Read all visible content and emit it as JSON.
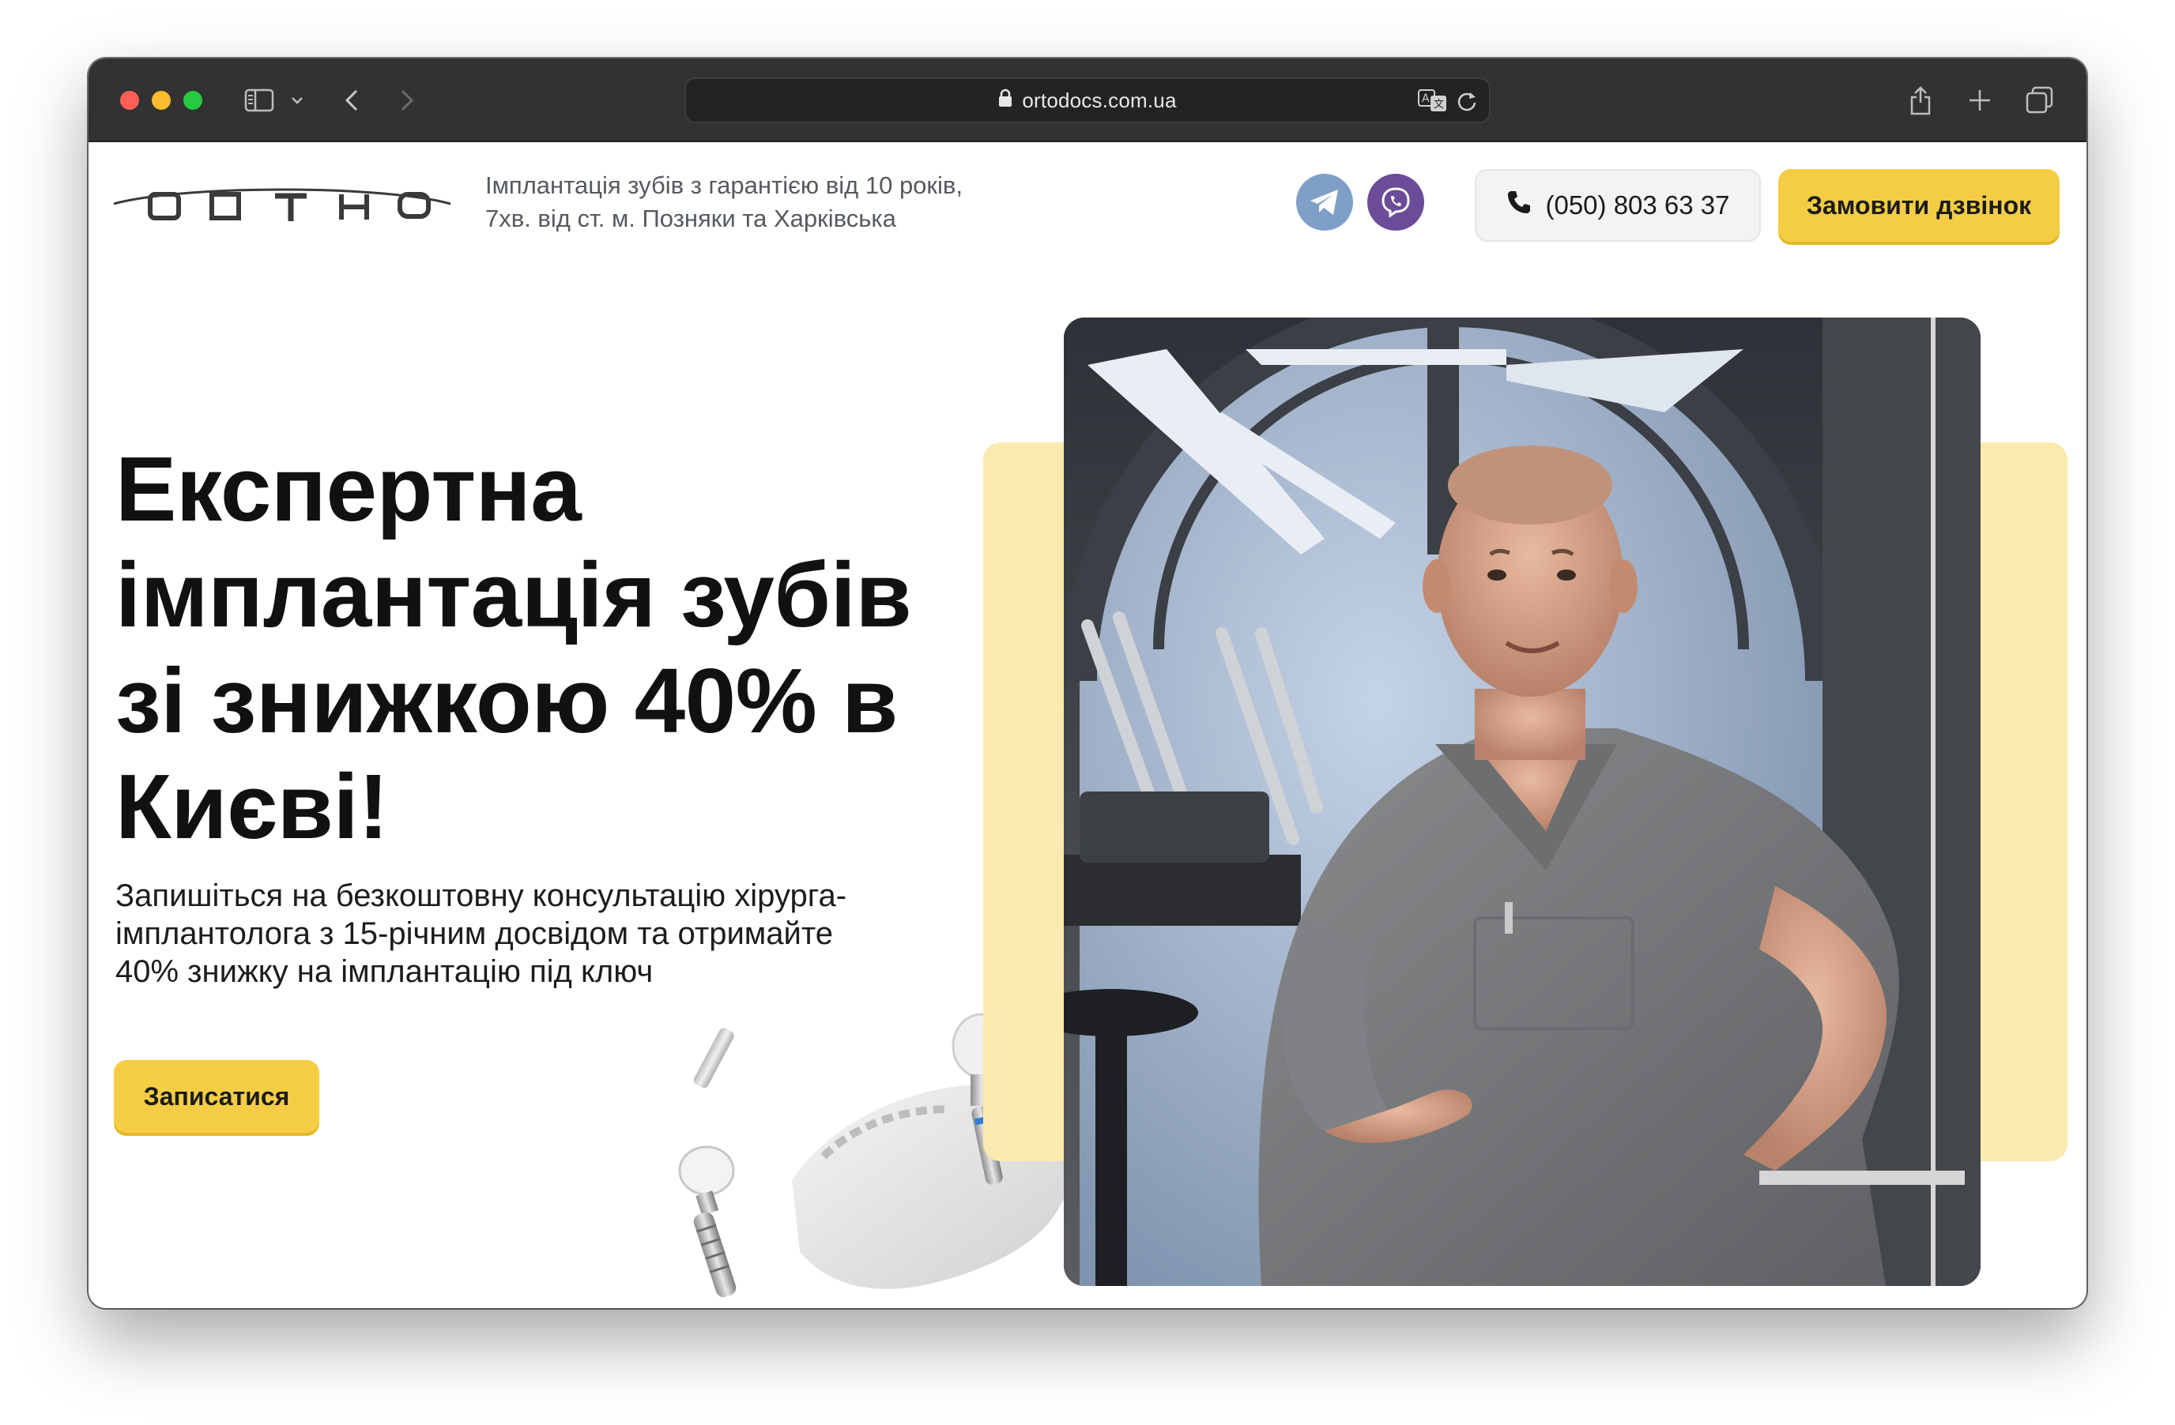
{
  "browser": {
    "url": "ortodocs.com.ua",
    "icons": [
      "sidebar-icon",
      "chevron-down-icon",
      "back-icon",
      "forward-icon",
      "lock-icon",
      "translate-icon",
      "reload-icon",
      "share-icon",
      "new-tab-icon",
      "tabs-overview-icon"
    ]
  },
  "header": {
    "logo_alt": "ORTHO",
    "tagline_line1": "Імплантація зубів з гарантією від 10 років,",
    "tagline_line2": "7хв. від ст. м. Позняки та Харківська",
    "phone": "(050) 803 63 37",
    "call_button": "Замовити дзвінок",
    "social_icons": [
      "telegram-icon",
      "viber-icon"
    ]
  },
  "hero": {
    "headline_line1": "Експертна",
    "headline_line2": "імплантація зубів",
    "headline_line3": "зі знижкою 40% в",
    "headline_line4": "Києві!",
    "subtext_line1": "Запишіться на безкоштовну консультацію хірурга-",
    "subtext_line2": "імплантолога з 15-річним досвідом та отримайте",
    "subtext_line3": "40% знижку на імплантацію під ключ",
    "cta_label": "Записатися"
  },
  "colors": {
    "accent": "#f5cd45",
    "accent_panel": "#fbeab0",
    "toolbar": "#323232",
    "text": "#111111"
  }
}
